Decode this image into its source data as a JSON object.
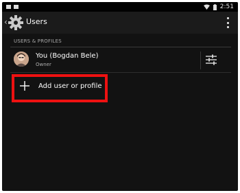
{
  "status_bar": {
    "time": "2:51",
    "left_icons": [
      "notification-icon",
      "notification-icon"
    ],
    "right_icons": [
      "wifi-icon",
      "battery-icon"
    ]
  },
  "action_bar": {
    "title": "Users",
    "icon": "gear-icon",
    "overflow_icon": "more-vert-icon"
  },
  "section": {
    "header": "USERS & PROFILES"
  },
  "users": [
    {
      "name": "You (Bogdan Bele)",
      "role": "Owner",
      "avatar": "avatar-photo",
      "action_icon": "sliders-icon"
    }
  ],
  "add_user": {
    "label": "Add user or profile",
    "icon": "plus-icon"
  },
  "colors": {
    "background": "#121212",
    "action_bar": "#1b1b1b",
    "highlight": "#ee1111",
    "text_primary": "#ffffff",
    "text_secondary": "#a9a9a9"
  }
}
